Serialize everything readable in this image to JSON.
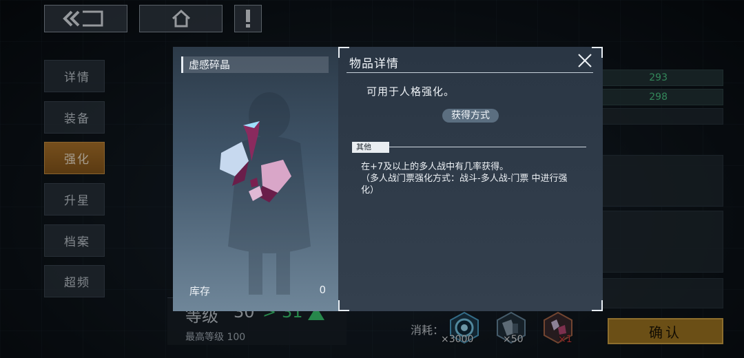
{
  "side_menu": [
    "详情",
    "装备",
    "强化",
    "升星",
    "档案",
    "超频"
  ],
  "side_menu_active_index": 2,
  "right_stats": [
    "293",
    "298"
  ],
  "level": {
    "label": "等级",
    "current": "30",
    "next": "31",
    "max_label": "最高等级 100"
  },
  "cost": {
    "label": "消耗：",
    "items": [
      {
        "icon": "coin-core-icon",
        "count": "×3000"
      },
      {
        "icon": "part-kit-icon",
        "count": "×50"
      },
      {
        "icon": "crystal-shard-icon",
        "count": "×1",
        "insufficient": true
      }
    ]
  },
  "confirm_label": "确认",
  "modal": {
    "item_name": "虚感碎晶",
    "stock_label": "库存",
    "stock_value": "0",
    "title": "物品详情",
    "description": "可用于人格强化。",
    "obtain_button": "获得方式",
    "section_tag": "其他",
    "other_text": "在+7及以上的多人战中有几率获得。\n（多人战门票强化方式：战斗-多人战-门票 中进行强化）"
  },
  "colors": {
    "accent": "#b5792c",
    "confirm": "#a57a22",
    "stat_green": "#4fd08a",
    "insufficient": "#e04040"
  }
}
